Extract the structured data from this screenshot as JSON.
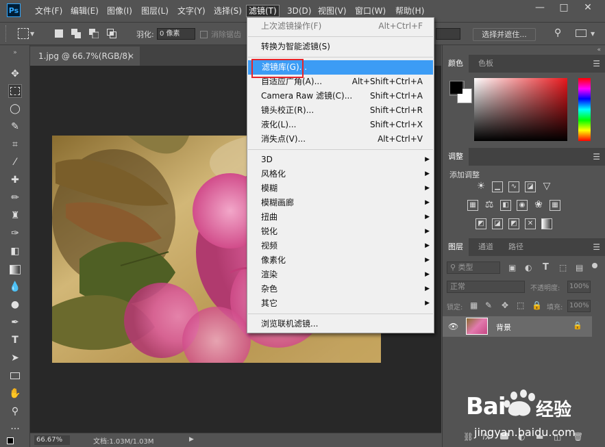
{
  "app": {
    "logo_text": "Ps",
    "menus": [
      "文件(F)",
      "编辑(E)",
      "图像(I)",
      "图层(L)",
      "文字(Y)",
      "选择(S)",
      "滤镜(T)",
      "3D(D)",
      "视图(V)",
      "窗口(W)",
      "帮助(H)"
    ],
    "active_menu_index": 6,
    "window_buttons": [
      "—",
      "□",
      "✕"
    ]
  },
  "options_bar": {
    "feather_label": "羽化:",
    "feather_value": "0 像素",
    "antialias_label": "消除锯齿",
    "select_mask_label": "选择并遮住..."
  },
  "document": {
    "tab_title": "1.jpg @ 66.7%(RGB/8)",
    "tab_close": "×",
    "zoom": "66.67%",
    "doc_size": "文档:1.03M/1.03M"
  },
  "filter_menu": {
    "items": [
      {
        "label": "上次滤镜操作(F)",
        "shortcut": "Alt+Ctrl+F",
        "disabled": true
      },
      {
        "sep": true
      },
      {
        "label": "转换为智能滤镜(S)",
        "shortcut": ""
      },
      {
        "sep": true
      },
      {
        "label": "滤镜库(G)...",
        "shortcut": "",
        "highlight": true
      },
      {
        "label": "自适应广角(A)...",
        "shortcut": "Alt+Shift+Ctrl+A"
      },
      {
        "label": "Camera Raw 滤镜(C)...",
        "shortcut": "Shift+Ctrl+A"
      },
      {
        "label": "镜头校正(R)...",
        "shortcut": "Shift+Ctrl+R"
      },
      {
        "label": "液化(L)...",
        "shortcut": "Shift+Ctrl+X"
      },
      {
        "label": "消失点(V)...",
        "shortcut": "Alt+Ctrl+V"
      },
      {
        "sep": true
      },
      {
        "label": "3D",
        "submenu": true
      },
      {
        "label": "风格化",
        "submenu": true
      },
      {
        "label": "模糊",
        "submenu": true
      },
      {
        "label": "模糊画廊",
        "submenu": true
      },
      {
        "label": "扭曲",
        "submenu": true
      },
      {
        "label": "锐化",
        "submenu": true
      },
      {
        "label": "视频",
        "submenu": true
      },
      {
        "label": "像素化",
        "submenu": true
      },
      {
        "label": "渲染",
        "submenu": true
      },
      {
        "label": "杂色",
        "submenu": true
      },
      {
        "label": "其它",
        "submenu": true
      },
      {
        "sep": true
      },
      {
        "label": "浏览联机滤镜..."
      }
    ]
  },
  "panels": {
    "color_tabs": [
      "颜色",
      "色板"
    ],
    "adjust_tab": "调整",
    "adjust_title": "添加调整",
    "layers_tabs": [
      "图层",
      "通道",
      "路径"
    ],
    "kind_filter": "类型",
    "blend_mode": "正常",
    "opacity_label": "不透明度:",
    "opacity_value": "100%",
    "lock_label": "锁定:",
    "fill_label": "填充:",
    "fill_value": "100%",
    "layer_name": "背景",
    "foreground_color": "#000000",
    "background_color": "#ffffff"
  },
  "watermark": {
    "brand": "Bai",
    "brand_suffix": "经验",
    "url": "jingyan.baidu.com"
  }
}
